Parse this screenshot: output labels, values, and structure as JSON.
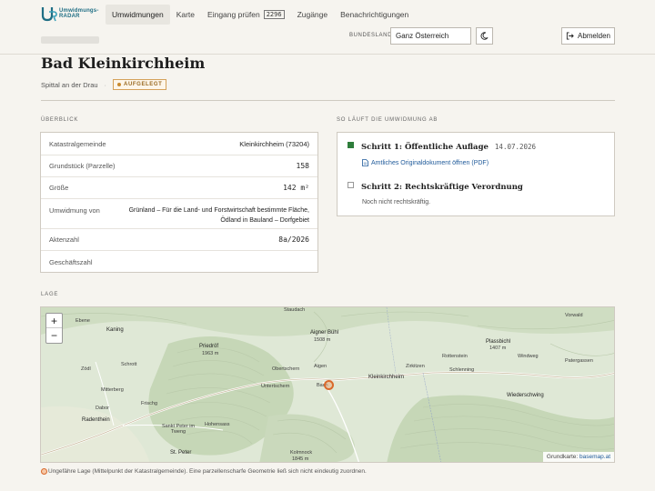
{
  "header": {
    "logo_text_1": "Umwidmungs-",
    "logo_text_2": "RADAR",
    "nav": [
      {
        "label": "Umwidmungen",
        "active": true
      },
      {
        "label": "Karte"
      },
      {
        "label": "Eingang prüfen",
        "badge": "2296"
      },
      {
        "label": "Zugänge"
      },
      {
        "label": "Benachrichtigungen"
      }
    ],
    "bundesland_label": "BUNDESLAND",
    "bundesland_value": "Ganz Österreich",
    "theme_icon": "moon-icon",
    "logout_label": "Abmelden"
  },
  "page": {
    "title": "Bad Kleinkirchheim",
    "district": "Spittal an der Drau",
    "status": "AUFGELEGT"
  },
  "overview": {
    "label": "ÜBERBLICK",
    "rows": [
      {
        "key": "Katastralgemeinde",
        "value": "Kleinkirchheim (73204)"
      },
      {
        "key": "Grundstück (Parzelle)",
        "value": "158"
      },
      {
        "key": "Größe",
        "value": "142 m²"
      },
      {
        "key": "Umwidmung von",
        "value_line1": "Grünland – Für die Land- und Forstwirtschaft bestimmte Fläche,",
        "value_line2": "Ödland in Bauland – Dorfgebiet"
      },
      {
        "key": "Aktenzahl",
        "value": "8a/2026"
      },
      {
        "key": "Geschäftszahl",
        "value": ""
      }
    ]
  },
  "process": {
    "label": "SO LÄUFT DIE UMWIDMUNG AB",
    "step1_title": "Schritt 1: Öffentliche Auflage",
    "step1_date": "14.07.2026",
    "step1_link": "Amtliches Originaldokument öffnen (PDF)",
    "step2_title": "Schritt 2: Rechtskräftige Verordnung",
    "step2_note": "Noch nicht rechtskräftig."
  },
  "map": {
    "label": "LAGE",
    "zoom_in": "+",
    "zoom_out": "−",
    "places": [
      "Ebene",
      "Kaning",
      "Zödl",
      "Schrott",
      "Mitterberg",
      "Dabor",
      "Radenthein",
      "Frischg",
      "Sankt Peter im Tweng",
      "Hohensass",
      "St. Peter",
      "Priedröf",
      "1963 m",
      "Staudach",
      "Aigner Bühl",
      "1508 m",
      "Aigen",
      "Obertschern",
      "Untertschern",
      "Bach",
      "Zirkitzen",
      "Kleinkirchheim",
      "Rottenstein",
      "Schlenning",
      "Plassbichl",
      "1407 m",
      "Windweg",
      "Patergassen",
      "Wiederschwing",
      "Kolmnock",
      "1845 m",
      "Vorwald"
    ],
    "attribution_prefix": "Grundkarte:",
    "attribution_link": "basemap.at",
    "note": "Ungefähre Lage (Mittelpunkt der Katastralgemeinde). Eine parzellenscharfe Geometrie ließ sich nicht eindeutig zuordnen."
  }
}
